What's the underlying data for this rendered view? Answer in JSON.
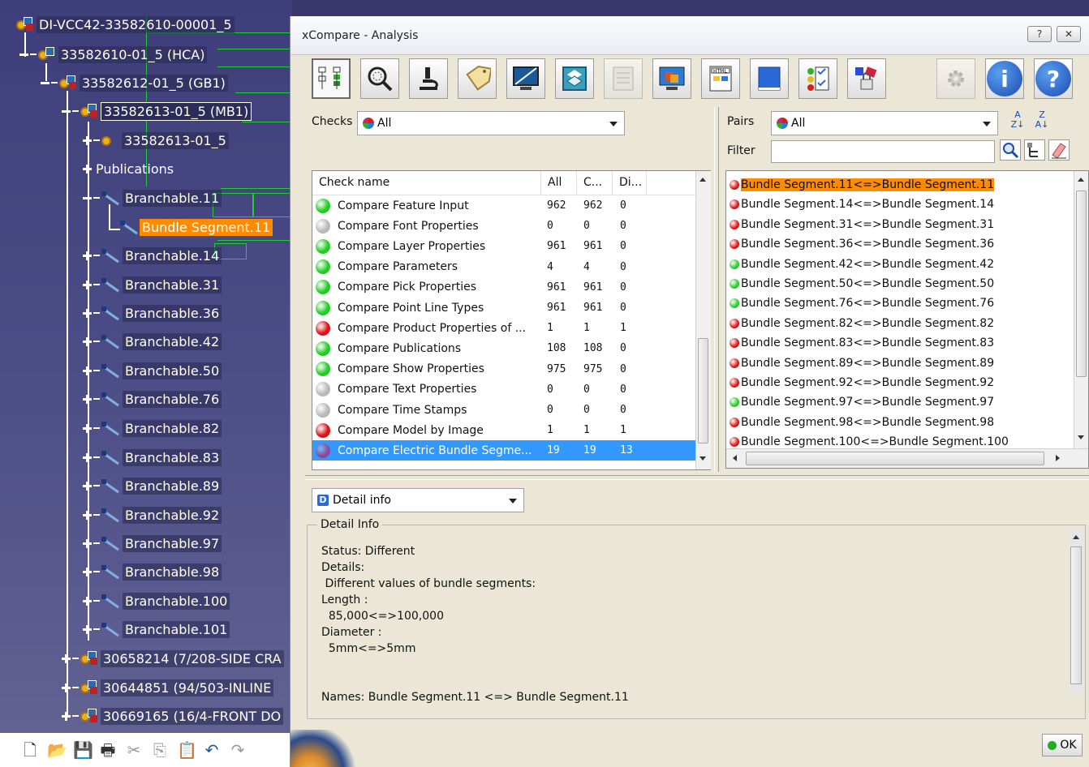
{
  "tree": {
    "root": "DI-VCC42-33582610-00001_5",
    "nodes": [
      {
        "label": "33582610-01_5 (HCA)"
      },
      {
        "label": "33582612-01_5 (GB1)"
      },
      {
        "label": "33582613-01_5 (MB1)"
      },
      {
        "label": "33582613-01_5"
      },
      {
        "label": "Publications"
      },
      {
        "label": "Branchable.11"
      },
      {
        "label": "Bundle Segment.11"
      },
      {
        "label": "Branchable.14"
      },
      {
        "label": "Branchable.31"
      },
      {
        "label": "Branchable.36"
      },
      {
        "label": "Branchable.42"
      },
      {
        "label": "Branchable.50"
      },
      {
        "label": "Branchable.76"
      },
      {
        "label": "Branchable.82"
      },
      {
        "label": "Branchable.83"
      },
      {
        "label": "Branchable.89"
      },
      {
        "label": "Branchable.92"
      },
      {
        "label": "Branchable.97"
      },
      {
        "label": "Branchable.98"
      },
      {
        "label": "Branchable.100"
      },
      {
        "label": "Branchable.101"
      },
      {
        "label": "30658214 (7/208-SIDE CRA"
      },
      {
        "label": "30644851 (94/503-INLINE"
      },
      {
        "label": "30669165 (16/4-FRONT DO"
      }
    ]
  },
  "dialog": {
    "title": "xCompare - Analysis",
    "help_btn": "?",
    "close_btn": "✕"
  },
  "checks": {
    "label": "Checks",
    "filter_value": "All",
    "columns": [
      "Check name",
      "All",
      "C...",
      "Di..."
    ],
    "rows": [
      {
        "name": "Compare Feature Input",
        "all": "962",
        "c": "962",
        "d": "0",
        "status": "green"
      },
      {
        "name": "Compare Font Properties",
        "all": "0",
        "c": "0",
        "d": "0",
        "status": "gray"
      },
      {
        "name": "Compare Layer Properties",
        "all": "961",
        "c": "961",
        "d": "0",
        "status": "green"
      },
      {
        "name": "Compare Parameters",
        "all": "4",
        "c": "4",
        "d": "0",
        "status": "green"
      },
      {
        "name": "Compare Pick Properties",
        "all": "961",
        "c": "961",
        "d": "0",
        "status": "green"
      },
      {
        "name": "Compare Point Line Types",
        "all": "961",
        "c": "961",
        "d": "0",
        "status": "green"
      },
      {
        "name": "Compare Product Properties of ...",
        "all": "1",
        "c": "1",
        "d": "1",
        "status": "red"
      },
      {
        "name": "Compare Publications",
        "all": "108",
        "c": "108",
        "d": "0",
        "status": "green"
      },
      {
        "name": "Compare Show Properties",
        "all": "975",
        "c": "975",
        "d": "0",
        "status": "green"
      },
      {
        "name": "Compare Text Properties",
        "all": "0",
        "c": "0",
        "d": "0",
        "status": "gray"
      },
      {
        "name": "Compare Time Stamps",
        "all": "0",
        "c": "0",
        "d": "0",
        "status": "gray"
      },
      {
        "name": "Compare Model by Image",
        "all": "1",
        "c": "1",
        "d": "1",
        "status": "red"
      },
      {
        "name": "Compare Electric Bundle Segme...",
        "all": "19",
        "c": "19",
        "d": "13",
        "status": "purple"
      }
    ]
  },
  "pairs": {
    "label": "Pairs",
    "filter_value": "All",
    "filter_label": "Filter",
    "filter_text": "",
    "rows": [
      {
        "label": "Bundle Segment.11<=>Bundle Segment.11",
        "status": "red"
      },
      {
        "label": "Bundle Segment.14<=>Bundle Segment.14",
        "status": "red"
      },
      {
        "label": "Bundle Segment.31<=>Bundle Segment.31",
        "status": "red"
      },
      {
        "label": "Bundle Segment.36<=>Bundle Segment.36",
        "status": "red"
      },
      {
        "label": "Bundle Segment.42<=>Bundle Segment.42",
        "status": "green"
      },
      {
        "label": "Bundle Segment.50<=>Bundle Segment.50",
        "status": "green"
      },
      {
        "label": "Bundle Segment.76<=>Bundle Segment.76",
        "status": "green"
      },
      {
        "label": "Bundle Segment.82<=>Bundle Segment.82",
        "status": "red"
      },
      {
        "label": "Bundle Segment.83<=>Bundle Segment.83",
        "status": "red"
      },
      {
        "label": "Bundle Segment.89<=>Bundle Segment.89",
        "status": "red"
      },
      {
        "label": "Bundle Segment.92<=>Bundle Segment.92",
        "status": "red"
      },
      {
        "label": "Bundle Segment.97<=>Bundle Segment.97",
        "status": "green"
      },
      {
        "label": "Bundle Segment.98<=>Bundle Segment.98",
        "status": "red"
      },
      {
        "label": "Bundle Segment.100<=>Bundle Segment.100",
        "status": "red"
      }
    ]
  },
  "detail": {
    "combo_value": "Detail info",
    "group_title": "Detail Info",
    "text": "Status: Different\nDetails:\n Different values of bundle segments:\nLength :\n  85,000<=>100,000\nDiameter :\n  5mm<=>5mm\n\n\nNames: Bundle Segment.11 <=> Bundle Segment.11"
  },
  "ok_label": "OK",
  "status_colors": {
    "green": "#22cc22",
    "gray": "#b8b8b8",
    "red": "#dd1111",
    "purple": "#8a4a9a",
    "selection": "#3399ff",
    "highlight": "#ff8c00"
  },
  "toolbar_icons": [
    "tree-compare-icon",
    "zoom-fit-icon",
    "microscope-icon",
    "tag-icon",
    "screen-icon",
    "layers-icon",
    "report-icon",
    "3d-view-icon",
    "html-report-icon",
    "book-icon",
    "checklist-icon",
    "lock-icon",
    "settings-icon",
    "info-icon",
    "help-icon"
  ]
}
